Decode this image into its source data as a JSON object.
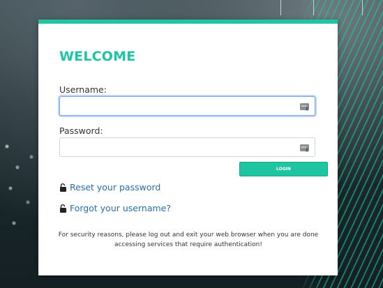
{
  "login": {
    "title": "WELCOME",
    "username_label": "Username:",
    "username_value": "",
    "password_label": "Password:",
    "password_value": "",
    "login_button": "LOGIN",
    "reset_password_link": "Reset your password",
    "forgot_username_link": "Forgot your username?",
    "security_notice": "For security reasons, please log out and exit your web browser when you are done accessing services that require authentication!"
  },
  "colors": {
    "accent": "#1fc4a0",
    "link": "#2a6ea6",
    "focus": "#7aa6e8"
  },
  "icons": {
    "field_icon": "password-manager-key-icon",
    "link_icon": "unlocked-padlock-icon"
  }
}
